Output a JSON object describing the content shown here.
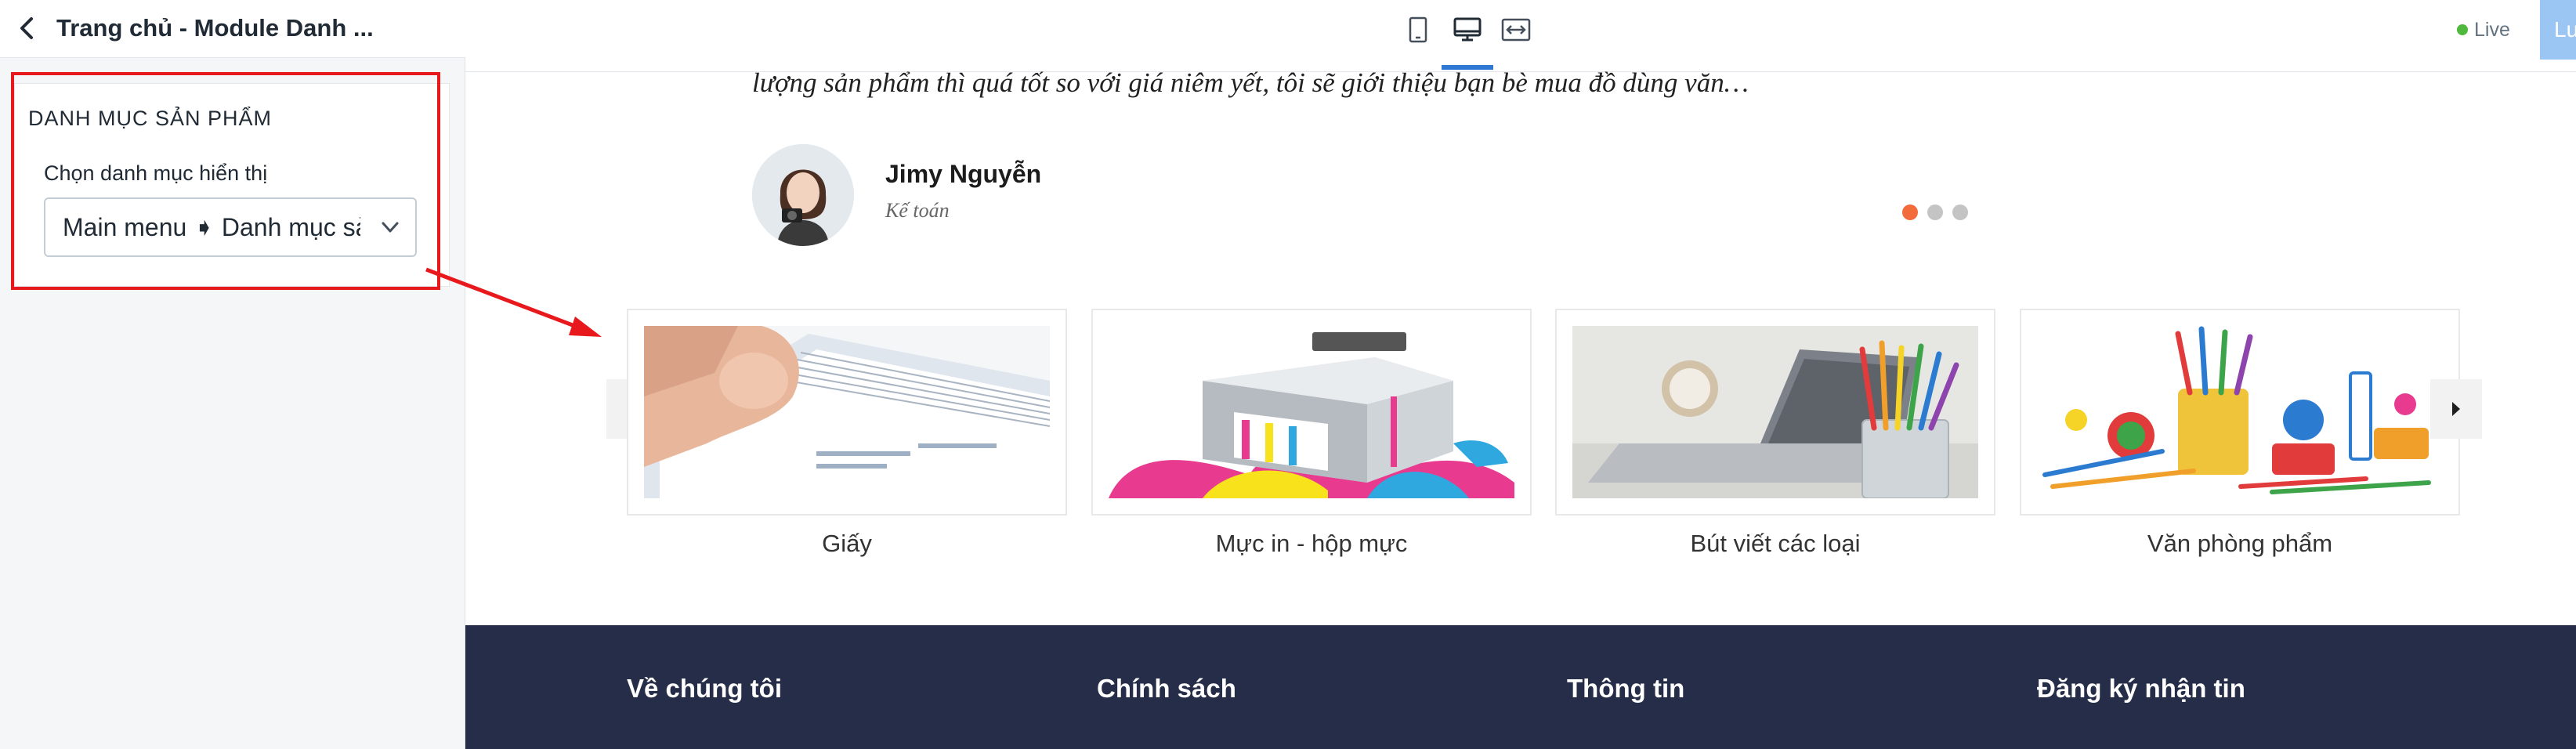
{
  "editor": {
    "title": "Trang chủ - Module Danh ...",
    "section": {
      "title": "DANH MỤC SẢN PHẨM",
      "field_label": "Chọn danh mục hiển thị",
      "select_value": "Main menu ➧ Danh mục sản phẩm"
    }
  },
  "toolbar": {
    "devices": [
      "mobile",
      "desktop",
      "full-width"
    ],
    "active_device": "desktop",
    "live_label": "Live",
    "save_label": "Lưu"
  },
  "preview": {
    "testimonial": {
      "quote": "lượng sản phẩm thì quá tốt so với giá niêm yết, tôi sẽ giới thiệu bạn bè mua đồ dùng văn…",
      "name": "Jimy Nguyễn",
      "role": "Kế toán",
      "dots": 3,
      "active_dot": 0
    },
    "categories": [
      {
        "label": "Giấy",
        "icon": "paper-stack-image"
      },
      {
        "label": "Mực in - hộp mực",
        "icon": "printer-ink-image"
      },
      {
        "label": "Bút viết các loại",
        "icon": "pencils-laptop-image"
      },
      {
        "label": "Văn phòng phẩm",
        "icon": "stationery-image"
      }
    ],
    "footer": {
      "columns": [
        "Về chúng tôi",
        "Chính sách",
        "Thông tin",
        "Đăng ký nhận tin"
      ]
    }
  },
  "colors": {
    "accent": "#2e78d4",
    "highlight_annotation": "#e8191c",
    "live_green": "#50b83c",
    "footer_bg": "#252d48",
    "dot_active": "#f26b3a",
    "dot_inactive": "#c4c4c4"
  }
}
